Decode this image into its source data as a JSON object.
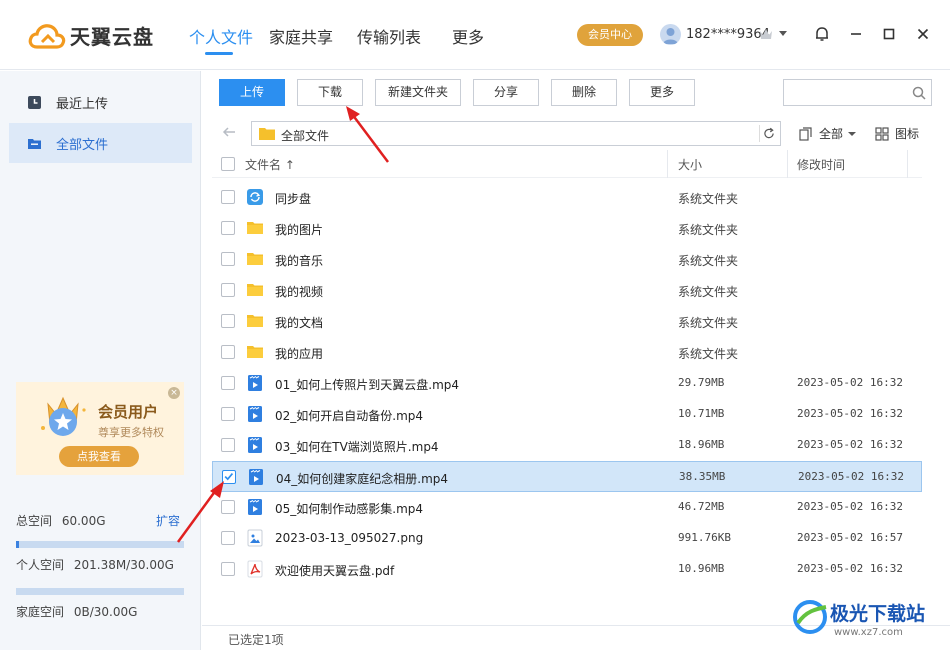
{
  "app": {
    "name": "天翼云盘",
    "nav_tabs": [
      {
        "label": "个人文件",
        "active": true
      },
      {
        "label": "家庭共享",
        "active": false
      },
      {
        "label": "传输列表",
        "active": false
      },
      {
        "label": "更多",
        "active": false
      }
    ],
    "vip_center": "会员中心",
    "username": "182****9364"
  },
  "sidebar": {
    "items": [
      {
        "label": "最近上传",
        "icon": "clock-icon",
        "active": false
      },
      {
        "label": "全部文件",
        "icon": "folder-icon",
        "active": true
      }
    ],
    "promo": {
      "title": "会员用户",
      "subtitle": "尊享更多特权",
      "button": "点我查看",
      "close": "×"
    },
    "storage": {
      "total_label": "总空间",
      "total_value": "60.00G",
      "expand_label": "扩容",
      "personal_label": "个人空间",
      "personal_value": "201.38M/30.00G",
      "personal_fraction": 0.02,
      "family_label": "家庭空间",
      "family_value": "0B/30.00G",
      "family_fraction": 0.0
    }
  },
  "toolbar": {
    "upload": "上传",
    "download": "下载",
    "new_folder": "新建文件夹",
    "share": "分享",
    "delete": "删除",
    "more": "更多",
    "search_placeholder": ""
  },
  "pathbar": {
    "path": "全部文件",
    "filter_label": "全部",
    "view_label": "图标"
  },
  "table": {
    "columns": {
      "name": "文件名 ↑",
      "size": "大小",
      "modified": "修改时间"
    },
    "rows": [
      {
        "name": "同步盘",
        "type": "sync",
        "size": "系统文件夹",
        "time": "",
        "checked": false
      },
      {
        "name": "我的图片",
        "type": "folder",
        "size": "系统文件夹",
        "time": "",
        "checked": false
      },
      {
        "name": "我的音乐",
        "type": "folder",
        "size": "系统文件夹",
        "time": "",
        "checked": false
      },
      {
        "name": "我的视频",
        "type": "folder",
        "size": "系统文件夹",
        "time": "",
        "checked": false
      },
      {
        "name": "我的文档",
        "type": "folder",
        "size": "系统文件夹",
        "time": "",
        "checked": false
      },
      {
        "name": "我的应用",
        "type": "folder",
        "size": "系统文件夹",
        "time": "",
        "checked": false
      },
      {
        "name": "01_如何上传照片到天翼云盘.mp4",
        "type": "video",
        "size": "29.79MB",
        "time": "2023-05-02 16:32",
        "checked": false
      },
      {
        "name": "02_如何开启自动备份.mp4",
        "type": "video",
        "size": "10.71MB",
        "time": "2023-05-02 16:32",
        "checked": false
      },
      {
        "name": "03_如何在TV端浏览照片.mp4",
        "type": "video",
        "size": "18.96MB",
        "time": "2023-05-02 16:32",
        "checked": false
      },
      {
        "name": "04_如何创建家庭纪念相册.mp4",
        "type": "video",
        "size": "38.35MB",
        "time": "2023-05-02 16:32",
        "checked": true
      },
      {
        "name": "05_如何制作动感影集.mp4",
        "type": "video",
        "size": "46.72MB",
        "time": "2023-05-02 16:32",
        "checked": false
      },
      {
        "name": "2023-03-13_095027.png",
        "type": "image",
        "size": "991.76KB",
        "time": "2023-05-02 16:57",
        "checked": false
      },
      {
        "name": "欢迎使用天翼云盘.pdf",
        "type": "pdf",
        "size": "10.96MB",
        "time": "2023-05-02 16:32",
        "checked": false
      }
    ]
  },
  "status": {
    "selected": "已选定1项"
  },
  "watermark": {
    "title": "极光下载站",
    "subtitle": "www.xz7.com"
  },
  "colors": {
    "accent": "#2c8ff0",
    "vip": "#e0a33b",
    "arrow": "#e02020"
  }
}
